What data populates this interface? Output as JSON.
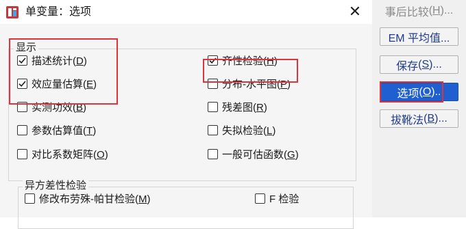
{
  "window": {
    "title": "单变量：选项",
    "close_glyph": "✕"
  },
  "display_group": {
    "label": "显示",
    "left_options": [
      {
        "text": "描述统计",
        "mnemonic": "D",
        "checked": true
      },
      {
        "text": "效应量估算",
        "mnemonic": "E",
        "checked": true
      },
      {
        "text": "实测功效",
        "mnemonic": "B",
        "checked": false
      },
      {
        "text": "参数估算值",
        "mnemonic": "T",
        "checked": false
      },
      {
        "text": "对比系数矩阵",
        "mnemonic": "O",
        "checked": false
      }
    ],
    "right_options": [
      {
        "text": "齐性检验",
        "mnemonic": "H",
        "checked": true
      },
      {
        "text": "分布-水平图",
        "mnemonic": "P",
        "checked": false
      },
      {
        "text": "残差图",
        "mnemonic": "R",
        "checked": false
      },
      {
        "text": "失拟检验",
        "mnemonic": "L",
        "checked": false
      },
      {
        "text": "一般可估函数",
        "mnemonic": "G",
        "checked": false
      }
    ]
  },
  "hetero_group": {
    "label": "异方差性检验",
    "options": [
      {
        "text": "修改布劳殊-帕甘检验",
        "mnemonic": "M",
        "checked": false
      },
      {
        "text": "F 检验",
        "mnemonic": "",
        "checked": false
      }
    ]
  },
  "side_buttons": [
    {
      "text": "事后比较",
      "mnemonic": "H",
      "suffix": "...",
      "state": "disabled"
    },
    {
      "text": "EM 平均值...",
      "mnemonic": "",
      "suffix": "",
      "state": "normal"
    },
    {
      "text": "保存",
      "mnemonic": "S",
      "suffix": "...",
      "state": "normal"
    },
    {
      "text": "选项",
      "mnemonic": "O",
      "suffix": "..",
      "state": "active"
    },
    {
      "text": "拔靴法",
      "mnemonic": "B",
      "suffix": "...",
      "state": "normal"
    }
  ],
  "colors": {
    "highlight_box": "#e0323c",
    "active_button": "#1f5fd0",
    "link_text": "#1f3a8a"
  }
}
